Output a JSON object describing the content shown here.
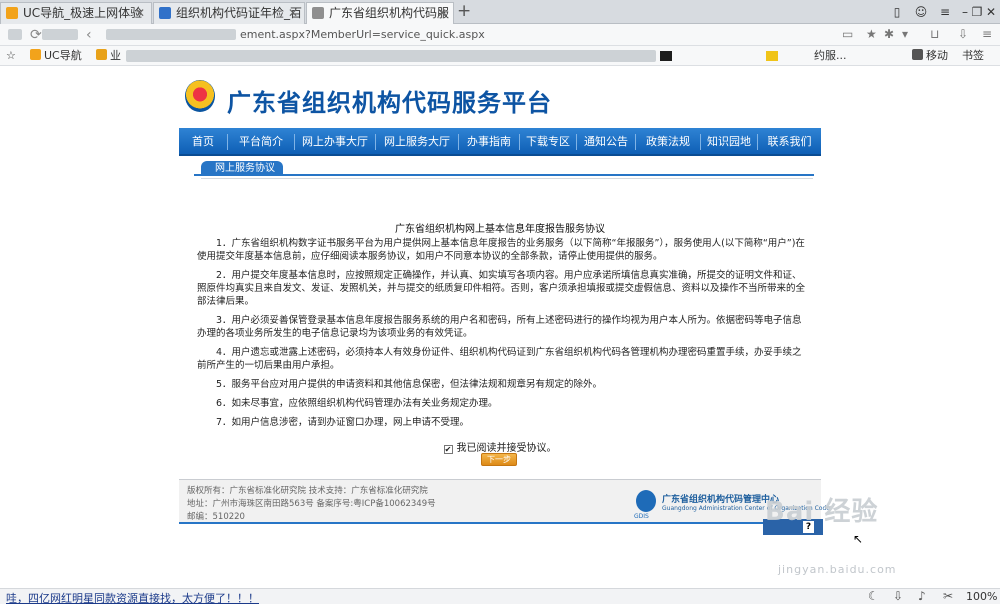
{
  "browser": {
    "tabs": [
      {
        "label": "UC导航_极速上网体验",
        "icon_color": "#f2a31b"
      },
      {
        "label": "组织机构代码证年检_百",
        "icon_color": "#3071c9"
      },
      {
        "label": "广东省组织机构代码服",
        "icon_color": "#8f8f8f"
      }
    ],
    "new_tab": "+",
    "window": {
      "minimize": "–",
      "restore": "❐",
      "close": "✕"
    },
    "url": "ement.aspx?MemberUrl=service_quick.aspx",
    "bookmarks": [
      {
        "label": "UC导航",
        "icon_color": "#f2a31b"
      },
      {
        "label": "业",
        "icon_color": "#e8a21a"
      },
      {
        "label": "约服...",
        "icon_color": "#777777"
      },
      {
        "label": "移动",
        "icon_color": "#555555"
      },
      {
        "label": "书签",
        "icon_color": "#555555"
      }
    ],
    "zoom": "100%",
    "status_link": "哇，四亿网红明星同款资源直接找，太方便了！！！"
  },
  "site": {
    "title": "广东省组织机构代码服务平台",
    "menu": [
      "首页",
      "平台简介",
      "网上办事大厅",
      "网上服务大厅",
      "办事指南",
      "下载专区",
      "通知公告",
      "政策法规",
      "知识园地",
      "联系我们"
    ],
    "breadcrumb": "网上服务协议"
  },
  "agreement": {
    "title": "广东省组织机构网上基本信息年度报告服务协议",
    "clauses": [
      "1．广东省组织机构数字证书服务平台为用户提供网上基本信息年度报告的业务服务（以下简称“年报服务”），服务使用人(以下简称“用户”)在使用提交年度基本信息前，应仔细阅读本服务协议，如用户不同意本协议的全部条款，请停止使用提供的服务。",
      "2．用户提交年度基本信息时，应按照规定正确操作，并认真、如实填写各项内容。用户应承诺所填信息真实准确，所提交的证明文件和证、照原件均真实且来自发文、发证、发照机关，并与提交的纸质复印件相符。否则，客户须承担填报或提交虚假信息、资料以及操作不当所带来的全部法律后果。",
      "3．用户必须妥善保管登录基本信息年度报告服务系统的用户名和密码，所有上述密码进行的操作均视为用户本人所为。依据密码等电子信息办理的各项业务所发生的电子信息记录均为该项业务的有效凭证。",
      "4．用户遗忘或泄露上述密码，必须持本人有效身份证件、组织机构代码证到广东省组织机构代码各管理机构办理密码重置手续，办妥手续之前所产生的一切后果由用户承担。",
      "5．服务平台应对用户提供的申请资料和其他信息保密，但法律法规和规章另有规定的除外。",
      "6．如未尽事宜，应依照组织机构代码管理办法有关业务规定办理。",
      "7．如用户信息涉密，请到办证窗口办理，网上申请不受理。"
    ],
    "checkbox_label": "我已阅读并接受协议。",
    "checkbox_mark": "✔",
    "next_button": "下一步"
  },
  "footer": {
    "copyright": "版权所有：广东省标准化研究院 技术支持：广东省标准化研究院",
    "address": "地址：广州市海珠区南田路563号 备案序号:粤ICP备10062349号",
    "postcode": "邮编：510220",
    "center_name": "广东省组织机构代码管理中心",
    "center_name_en": "Guangdong Administration Center of Organization Code",
    "logo_text": "GDIS"
  },
  "watermark": {
    "brand": "Bai  经验",
    "url": "jingyan.baidu.com"
  },
  "float_help": "?"
}
